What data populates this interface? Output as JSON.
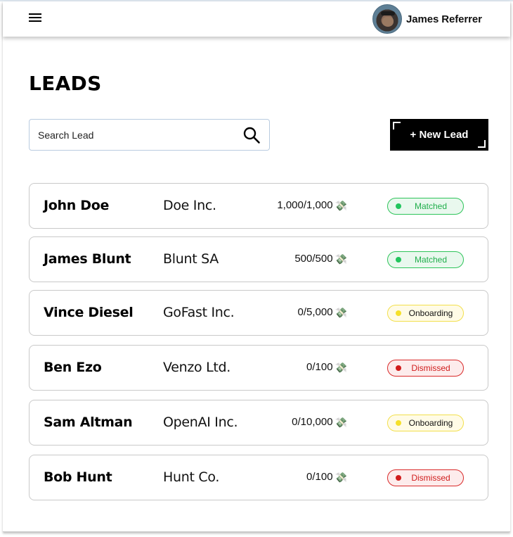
{
  "header": {
    "menu_icon": "hamburger-menu-icon",
    "user": {
      "name": "James Referrer",
      "avatar": "user-avatar-photo"
    }
  },
  "page": {
    "title": "LEADS"
  },
  "search": {
    "placeholder": "Search Lead",
    "value": "",
    "icon": "search-icon"
  },
  "new_lead_button": {
    "label": "+ New Lead"
  },
  "status_styles": {
    "Matched": {
      "text": "#1fae4b",
      "border": "#2ec45a",
      "bg": "#e9f8ee",
      "dot": "#22c55e"
    },
    "Onboarding": {
      "text": "#111111",
      "border": "#f2df4b",
      "bg": "#fffbe6",
      "dot": "#f5e02a"
    },
    "Dismissed": {
      "text": "#d01c1c",
      "border": "#d92a2a",
      "bg": "#fdecec",
      "dot": "#d01c1c"
    }
  },
  "leads": [
    {
      "name": "John Doe",
      "company": "Doe Inc.",
      "amount": "1,000/1,000",
      "amount_icon": "money-with-wings-icon",
      "status": "Matched"
    },
    {
      "name": "James Blunt",
      "company": "Blunt SA",
      "amount": "500/500",
      "amount_icon": "money-with-wings-icon",
      "status": "Matched"
    },
    {
      "name": "Vince Diesel",
      "company": "GoFast Inc.",
      "amount": "0/5,000",
      "amount_icon": "money-with-wings-icon",
      "status": "Onboarding"
    },
    {
      "name": "Ben Ezo",
      "company": "Venzo Ltd.",
      "amount": "0/100",
      "amount_icon": "money-with-wings-icon",
      "status": "Dismissed"
    },
    {
      "name": "Sam Altman",
      "company": "OpenAI Inc.",
      "amount": "0/10,000",
      "amount_icon": "money-with-wings-icon",
      "status": "Onboarding"
    },
    {
      "name": "Bob Hunt",
      "company": "Hunt Co.",
      "amount": "0/100",
      "amount_icon": "money-with-wings-icon",
      "status": "Dismissed"
    }
  ]
}
